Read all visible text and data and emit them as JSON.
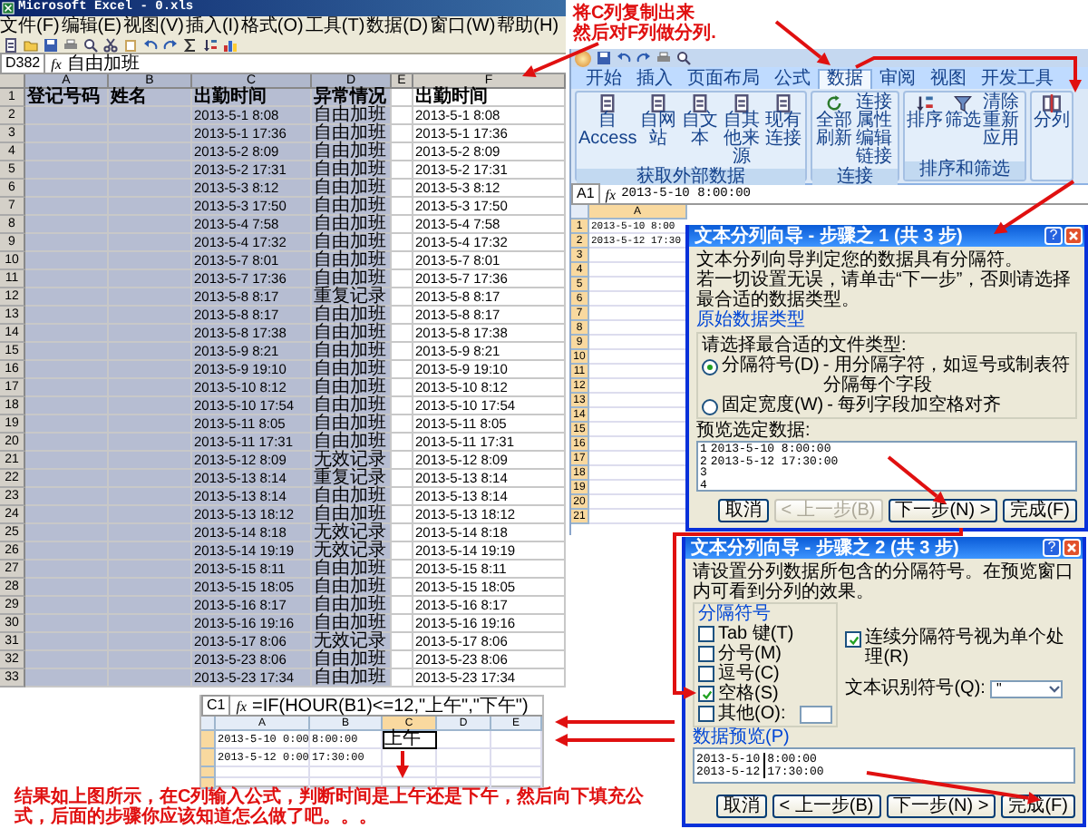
{
  "annotation_top": [
    "将C列复制出来",
    "然后对F列做分列."
  ],
  "excel_2003": {
    "title": "Microsoft Excel - 0.xls",
    "menu": [
      "文件(F)",
      "编辑(E)",
      "视图(V)",
      "插入(I)",
      "格式(O)",
      "工具(T)",
      "数据(D)",
      "窗口(W)",
      "帮助(H)"
    ],
    "name_box": "D382",
    "function_label": "fx",
    "formula": "自由加班",
    "columns": [
      {
        "letter": "A",
        "selected": true
      },
      {
        "letter": "B",
        "selected": true
      },
      {
        "letter": "C",
        "selected": true
      },
      {
        "letter": "D",
        "selected": true
      },
      {
        "letter": "E",
        "selected": false
      },
      {
        "letter": "F",
        "selected": false
      }
    ],
    "rows": [
      {
        "number": "1",
        "kind": "header",
        "a": "登记号码",
        "b": "姓名",
        "c": "出勤时间",
        "d": "异常情况",
        "f": "出勤时间"
      },
      {
        "number": "2",
        "kind": "data",
        "c": "2013-5-1 8:08",
        "d": "自由加班",
        "f": "2013-5-1 8:08"
      },
      {
        "number": "3",
        "kind": "data",
        "c": "2013-5-1 17:36",
        "d": "自由加班",
        "f": "2013-5-1 17:36"
      },
      {
        "number": "4",
        "kind": "data",
        "c": "2013-5-2 8:09",
        "d": "自由加班",
        "f": "2013-5-2 8:09"
      },
      {
        "number": "5",
        "kind": "data",
        "c": "2013-5-2 17:31",
        "d": "自由加班",
        "f": "2013-5-2 17:31"
      },
      {
        "number": "6",
        "kind": "data",
        "c": "2013-5-3 8:12",
        "d": "自由加班",
        "f": "2013-5-3 8:12"
      },
      {
        "number": "7",
        "kind": "data",
        "c": "2013-5-3 17:50",
        "d": "自由加班",
        "f": "2013-5-3 17:50"
      },
      {
        "number": "8",
        "kind": "data",
        "c": "2013-5-4 7:58",
        "d": "自由加班",
        "f": "2013-5-4 7:58"
      },
      {
        "number": "9",
        "kind": "data",
        "c": "2013-5-4 17:32",
        "d": "自由加班",
        "f": "2013-5-4 17:32"
      },
      {
        "number": "10",
        "kind": "data",
        "c": "2013-5-7 8:01",
        "d": "自由加班",
        "f": "2013-5-7 8:01"
      },
      {
        "number": "11",
        "kind": "data",
        "c": "2013-5-7 17:36",
        "d": "自由加班",
        "f": "2013-5-7 17:36"
      },
      {
        "number": "12",
        "kind": "data",
        "c": "2013-5-8 8:17",
        "d": "重复记录",
        "f": "2013-5-8 8:17"
      },
      {
        "number": "13",
        "kind": "data",
        "c": "2013-5-8 8:17",
        "d": "自由加班",
        "f": "2013-5-8 8:17"
      },
      {
        "number": "14",
        "kind": "data",
        "c": "2013-5-8 17:38",
        "d": "自由加班",
        "f": "2013-5-8 17:38"
      },
      {
        "number": "15",
        "kind": "data",
        "c": "2013-5-9 8:21",
        "d": "自由加班",
        "f": "2013-5-9 8:21"
      },
      {
        "number": "16",
        "kind": "data",
        "c": "2013-5-9 19:10",
        "d": "自由加班",
        "f": "2013-5-9 19:10"
      },
      {
        "number": "17",
        "kind": "data",
        "c": "2013-5-10 8:12",
        "d": "自由加班",
        "f": "2013-5-10 8:12"
      },
      {
        "number": "18",
        "kind": "data",
        "c": "2013-5-10 17:54",
        "d": "自由加班",
        "f": "2013-5-10 17:54"
      },
      {
        "number": "19",
        "kind": "data",
        "c": "2013-5-11 8:05",
        "d": "自由加班",
        "f": "2013-5-11 8:05"
      },
      {
        "number": "20",
        "kind": "data",
        "c": "2013-5-11 17:31",
        "d": "自由加班",
        "f": "2013-5-11 17:31"
      },
      {
        "number": "21",
        "kind": "data",
        "c": "2013-5-12 8:09",
        "d": "无效记录",
        "f": "2013-5-12 8:09"
      },
      {
        "number": "22",
        "kind": "data",
        "c": "2013-5-13 8:14",
        "d": "重复记录",
        "f": "2013-5-13 8:14"
      },
      {
        "number": "23",
        "kind": "data",
        "c": "2013-5-13 8:14",
        "d": "自由加班",
        "f": "2013-5-13 8:14"
      },
      {
        "number": "24",
        "kind": "data",
        "c": "2013-5-13 18:12",
        "d": "自由加班",
        "f": "2013-5-13 18:12"
      },
      {
        "number": "25",
        "kind": "data",
        "c": "2013-5-14 8:18",
        "d": "无效记录",
        "f": "2013-5-14 8:18"
      },
      {
        "number": "26",
        "kind": "data",
        "c": "2013-5-14 19:19",
        "d": "无效记录",
        "f": "2013-5-14 19:19"
      },
      {
        "number": "27",
        "kind": "data",
        "c": "2013-5-15 8:11",
        "d": "自由加班",
        "f": "2013-5-15 8:11"
      },
      {
        "number": "28",
        "kind": "data",
        "c": "2013-5-15 18:05",
        "d": "自由加班",
        "f": "2013-5-15 18:05"
      },
      {
        "number": "29",
        "kind": "data",
        "c": "2013-5-16 8:17",
        "d": "自由加班",
        "f": "2013-5-16 8:17"
      },
      {
        "number": "30",
        "kind": "data",
        "c": "2013-5-16 19:16",
        "d": "自由加班",
        "f": "2013-5-16 19:16"
      },
      {
        "number": "31",
        "kind": "data",
        "c": "2013-5-17 8:06",
        "d": "无效记录",
        "f": "2013-5-17 8:06"
      },
      {
        "number": "32",
        "kind": "data",
        "c": "2013-5-23 8:06",
        "d": "自由加班",
        "f": "2013-5-23 8:06"
      },
      {
        "number": "33",
        "kind": "data",
        "c": "2013-5-23 17:34",
        "d": "自由加班",
        "f": "2013-5-23 17:34"
      }
    ]
  },
  "excel_2007": {
    "tabs": [
      {
        "label": "开始",
        "selected": false
      },
      {
        "label": "插入",
        "selected": false
      },
      {
        "label": "页面布局",
        "selected": false
      },
      {
        "label": "公式",
        "selected": false
      },
      {
        "label": "数据",
        "selected": true
      },
      {
        "label": "审阅",
        "selected": false
      },
      {
        "label": "视图",
        "selected": false
      },
      {
        "label": "开发工具",
        "selected": false
      }
    ],
    "ribbon_groups": [
      {
        "label": "获取外部数据",
        "buttons": [
          {
            "kind": "source",
            "label": "自 Access"
          },
          {
            "kind": "source",
            "label": "自网站"
          },
          {
            "kind": "source",
            "label": "自文本"
          },
          {
            "kind": "source",
            "label": "自其他来源"
          },
          {
            "kind": "source",
            "label": "现有连接"
          }
        ]
      },
      {
        "label": "连接",
        "buttons": [
          {
            "kind": "refresh",
            "label": "全部刷新"
          },
          {
            "kind": "stack",
            "items": [
              "连接",
              "属性",
              "编辑链接"
            ]
          }
        ]
      },
      {
        "label": "排序和筛选",
        "buttons": [
          {
            "kind": "sort",
            "label": "排序"
          },
          {
            "kind": "filter",
            "label": "筛选"
          },
          {
            "kind": "stack",
            "items": [
              "清除",
              "重新应用"
            ]
          }
        ]
      },
      {
        "buttons": [
          {
            "kind": "split",
            "label": "分列"
          }
        ]
      }
    ],
    "name_box": "A1",
    "function_label": "fx",
    "formula": "2013-5-10  8:00:00",
    "columns": [
      {
        "letter": "A",
        "selected": true
      }
    ],
    "rows": [
      {
        "number": "1",
        "value": "2013-5-10 8:00"
      },
      {
        "number": "2",
        "value": "2013-5-12 17:30"
      },
      {
        "number": "3"
      },
      {
        "number": "4"
      },
      {
        "number": "5"
      },
      {
        "number": "6"
      },
      {
        "number": "7"
      },
      {
        "number": "8"
      },
      {
        "number": "9"
      },
      {
        "number": "10"
      },
      {
        "number": "11"
      },
      {
        "number": "12"
      },
      {
        "number": "13"
      },
      {
        "number": "14"
      },
      {
        "number": "15"
      },
      {
        "number": "16"
      },
      {
        "number": "17"
      },
      {
        "number": "18"
      },
      {
        "number": "19"
      },
      {
        "number": "20"
      },
      {
        "number": "21"
      }
    ]
  },
  "dialog_1": {
    "title": "文本分列向导 - 步骤之 1 (共 3 步)",
    "help_button": "?",
    "lines": [
      "文本分列向导判定您的数据具有分隔符。",
      "若一切设置无误，请单击“下一步”，否则请选择最合适的数据类型。"
    ],
    "section": "原始数据类型",
    "prompt": "请选择最合适的文件类型:",
    "options": [
      {
        "label": "分隔符号(D)",
        "description": "- 用分隔字符，如逗号或制表符分隔每个字段",
        "selected": true
      },
      {
        "label": "固定宽度(W)",
        "description": "- 每列字段加空格对齐",
        "selected": false
      }
    ],
    "preview_label": "预览选定数据:",
    "preview_lines": [
      {
        "number": "1",
        "text": "2013-5-10  8:00:00"
      },
      {
        "number": "2",
        "text": "2013-5-12  17:30:00"
      },
      {
        "number": "3"
      },
      {
        "number": "4"
      }
    ],
    "buttons": [
      {
        "label": "取消",
        "disabled": false
      },
      {
        "label": "< 上一步(B)",
        "disabled": true
      },
      {
        "label": "下一步(N) >",
        "disabled": false
      },
      {
        "label": "完成(F)",
        "disabled": false
      }
    ]
  },
  "dialog_2": {
    "title": "文本分列向导 - 步骤之 2 (共 3 步)",
    "help_button": "?",
    "instruction": "请设置分列数据所包含的分隔符号。在预览窗口内可看到分列的效果。",
    "group_label": "分隔符号",
    "delimiters": [
      {
        "kind": "plain",
        "label": "Tab 键(T)",
        "checked": false
      },
      {
        "kind": "plain",
        "label": "分号(M)",
        "checked": false
      },
      {
        "kind": "plain",
        "label": "逗号(C)",
        "checked": false
      },
      {
        "kind": "plain",
        "label": "空格(S)",
        "checked": true
      },
      {
        "kind": "with_field",
        "label": "其他(O):",
        "checked": false
      }
    ],
    "consecutive": {
      "label": "连续分隔符号视为单个处理(R)",
      "checked": true
    },
    "qualifier": {
      "label": "文本识别符号(Q):",
      "value": "\""
    },
    "preview_label": "数据预览(P)",
    "preview_rows": [
      {
        "cells": [
          "2013-5-10",
          "8:00:00"
        ]
      },
      {
        "cells": [
          "2013-5-12",
          "17:30:00"
        ]
      }
    ],
    "buttons": [
      {
        "label": "取消",
        "disabled": false
      },
      {
        "label": "< 上一步(B)",
        "disabled": false
      },
      {
        "label": "下一步(N) >",
        "disabled": false
      },
      {
        "label": "完成(F)",
        "disabled": false
      }
    ]
  },
  "small_excel": {
    "name_box": "C1",
    "function_label": "fx",
    "formula": "=IF(HOUR(B1)<=12,\"上午\",\"下午\")",
    "columns": [
      {
        "letter": "A",
        "selected": false
      },
      {
        "letter": "B",
        "selected": false
      },
      {
        "letter": "C",
        "selected": true
      },
      {
        "letter": "D",
        "selected": false
      },
      {
        "letter": "E",
        "selected": false
      }
    ],
    "rows": [
      {
        "cells": [
          "2013-5-10 0:00",
          "8:00:00",
          "上午"
        ]
      },
      {
        "cells": [
          "2013-5-12 0:00",
          "17:30:00"
        ]
      },
      {
        "cells": []
      },
      {
        "cells": []
      }
    ]
  },
  "annotation_bottom": "结果如上图所示，在C列输入公式，判断时间是上午还是下午，然后向下填充公式，后面的步骤你应该知道怎么做了吧。。。"
}
